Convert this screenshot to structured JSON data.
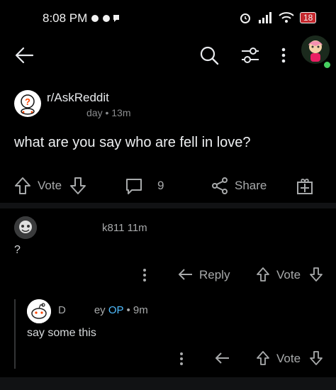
{
  "status_bar": {
    "time": "8:08 PM",
    "battery": "18"
  },
  "post": {
    "subreddit": "r/AskReddit",
    "meta_suffix": "day • 13m",
    "title": "what are you say who are fell in love?",
    "vote_label": "Vote",
    "comment_count": "9",
    "share_label": "Share"
  },
  "comment": {
    "user_suffix": "k811",
    "age": "11m",
    "body": "?",
    "reply_label": "Reply",
    "vote_label": "Vote"
  },
  "reply": {
    "user_prefix": "D",
    "user_suffix": "ey",
    "op_badge": "OP",
    "age": "• 9m",
    "body": "say some this",
    "vote_label": "Vote"
  },
  "colors": {
    "background": "#000000",
    "op": "#4fbcff",
    "online": "#46d160"
  }
}
